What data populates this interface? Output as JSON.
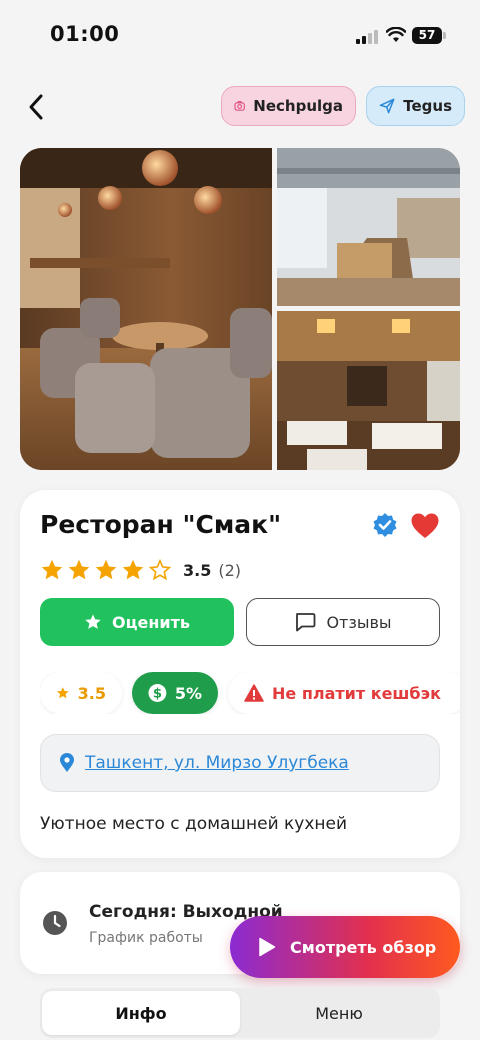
{
  "status_bar": {
    "time": "01:00",
    "battery": "57"
  },
  "header": {
    "instagram_label": "Nechpulga",
    "telegram_label": "Tegus"
  },
  "restaurant": {
    "name": "Ресторан \"Смак\"",
    "rating": "3.5",
    "rating_count": "(2)",
    "stars_filled": 4,
    "stars_total": 5,
    "rate_button": "Оценить",
    "reviews_button": "Отзывы",
    "badge_rating": "3.5",
    "badge_cashback": "5%",
    "badge_warning": "Не платит кешбэк",
    "address": "Ташкент, ул. Мирзо Улугбека",
    "description": "Уютное место с домашней кухней"
  },
  "schedule": {
    "title": "Сегодня: Выходной",
    "subtitle": "График работы"
  },
  "watch_button": "Смотреть обзор",
  "tabs": [
    {
      "label": "Инфо",
      "active": true
    },
    {
      "label": "Меню",
      "active": false
    }
  ],
  "colors": {
    "accent_green": "#21c25e",
    "cashback_green": "#1f9d4a",
    "warning_red": "#e23b3b",
    "star": "#f5a300",
    "link": "#2b88d8",
    "heart": "#e53935"
  }
}
